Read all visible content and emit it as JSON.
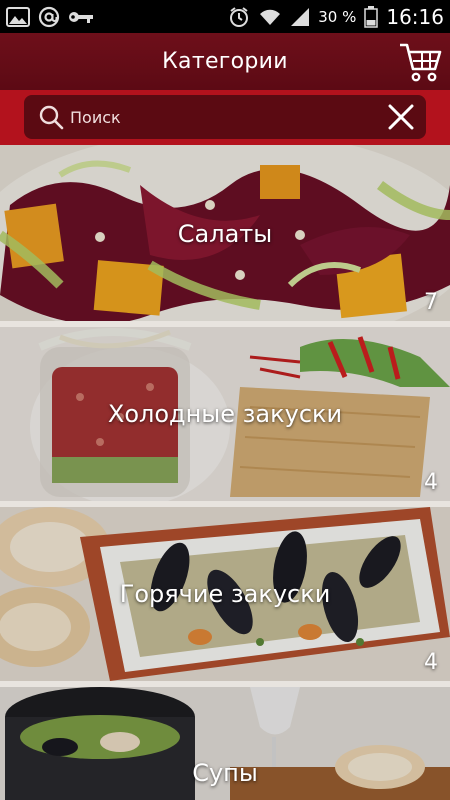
{
  "status_bar": {
    "battery_percent": "30 %",
    "time": "16:16",
    "icons": [
      "gallery-icon",
      "at-icon",
      "key-icon",
      "alarm-icon",
      "wifi-icon",
      "signal-icon",
      "battery-icon"
    ]
  },
  "header": {
    "title": "Категории",
    "cart_icon": "cart-icon"
  },
  "search": {
    "placeholder": "Поиск",
    "search_icon": "search-icon",
    "clear_icon": "close-icon"
  },
  "categories": [
    {
      "name": "Салаты",
      "count": "7"
    },
    {
      "name": "Холодные закуски",
      "count": "4"
    },
    {
      "name": "Горячие закуски",
      "count": "4"
    },
    {
      "name": "Супы",
      "count": ""
    }
  ],
  "colors": {
    "header_bg": "#6e0f1a",
    "search_bar_bg": "#b3121d",
    "search_field_bg": "#5b0a12"
  }
}
